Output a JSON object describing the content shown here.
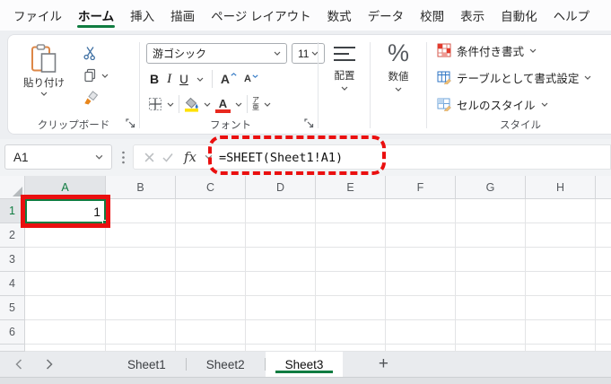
{
  "menubar": {
    "tabs": [
      {
        "label": "ファイル",
        "active": false
      },
      {
        "label": "ホーム",
        "active": true
      },
      {
        "label": "挿入",
        "active": false
      },
      {
        "label": "描画",
        "active": false
      },
      {
        "label": "ページ レイアウト",
        "active": false
      },
      {
        "label": "数式",
        "active": false
      },
      {
        "label": "データ",
        "active": false
      },
      {
        "label": "校閲",
        "active": false
      },
      {
        "label": "表示",
        "active": false
      },
      {
        "label": "自動化",
        "active": false
      },
      {
        "label": "ヘルプ",
        "active": false
      }
    ]
  },
  "ribbon": {
    "clipboard": {
      "paste_label": "貼り付け",
      "group_label": "クリップボード"
    },
    "font": {
      "font_name": "游ゴシック",
      "font_size": "11",
      "bold": "B",
      "italic": "I",
      "underline": "U",
      "grow_letter": "A",
      "shrink_letter": "A",
      "color_letter": "A",
      "ruby_top": "ア",
      "ruby_bottom": "亜",
      "group_label": "フォント"
    },
    "alignment": {
      "label": "配置"
    },
    "number": {
      "label": "数値",
      "percent": "%"
    },
    "styles": {
      "items": [
        {
          "label": "条件付き書式"
        },
        {
          "label": "テーブルとして書式設定"
        },
        {
          "label": "セルのスタイル"
        }
      ],
      "group_label": "スタイル"
    }
  },
  "formula_bar": {
    "name_box": "A1",
    "fx_label": "fx",
    "formula": "=SHEET(Sheet1!A1)"
  },
  "grid": {
    "column_headers": [
      "A",
      "B",
      "C",
      "D",
      "E",
      "F",
      "G",
      "H"
    ],
    "row_headers": [
      "1",
      "2",
      "3",
      "4",
      "5",
      "6"
    ],
    "active_cell": {
      "ref": "A1",
      "value": "1"
    }
  },
  "sheet_tabs": {
    "tabs": [
      {
        "label": "Sheet1",
        "active": false
      },
      {
        "label": "Sheet2",
        "active": false
      },
      {
        "label": "Sheet3",
        "active": true
      }
    ],
    "add_label": "+"
  },
  "colors": {
    "accent_green": "#107c41",
    "annotation_red": "#ea0f0f",
    "fill_yellow": "#ffe100",
    "font_color_red": "#e8281e"
  }
}
